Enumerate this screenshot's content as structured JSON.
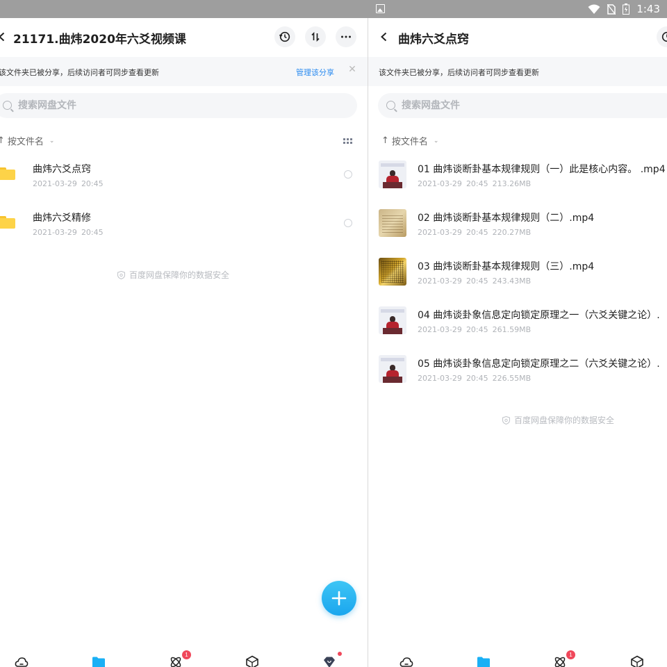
{
  "status_bar": {
    "time": "1:43"
  },
  "left_pane": {
    "title": "21171.曲炜2020年六爻视频课",
    "share_banner": {
      "text": "该文件夹已被分享，后续访问者可同步查看更新",
      "manage_link": "管理该分享"
    },
    "search": {
      "placeholder": "搜索网盘文件"
    },
    "sort_label": "按文件名",
    "items": [
      {
        "name": "曲炜六爻点窍",
        "date": "2021-03-29",
        "time": "20:45"
      },
      {
        "name": "曲炜六爻精修",
        "date": "2021-03-29",
        "time": "20:45"
      }
    ],
    "footer_note": "百度网盘保障你的数据安全",
    "tabbar": {
      "share_badge": "1"
    }
  },
  "right_pane": {
    "title": "曲炜六爻点窍",
    "share_banner": {
      "text": "该文件夹已被分享，后续访问者可同步查看更新"
    },
    "search": {
      "placeholder": "搜索网盘文件"
    },
    "sort_label": "按文件名",
    "items": [
      {
        "name": "01 曲炜谈断卦基本规律规则（一）此是核心内容。 .mp4",
        "date": "2021-03-29",
        "time": "20:45",
        "size": "213.26MB",
        "thumb": "person"
      },
      {
        "name": "02 曲炜谈断卦基本规律规则（二）.mp4",
        "date": "2021-03-29",
        "time": "20:45",
        "size": "220.27MB",
        "thumb": "paper"
      },
      {
        "name": "03 曲炜谈断卦基本规律规则（三）.mp4",
        "date": "2021-03-29",
        "time": "20:45",
        "size": "243.43MB",
        "thumb": "gold"
      },
      {
        "name": "04 曲炜谈卦象信息定向锁定原理之一（六爻关键之论）.",
        "date": "2021-03-29",
        "time": "20:45",
        "size": "261.59MB",
        "thumb": "person"
      },
      {
        "name": "05 曲炜谈卦象信息定向锁定原理之二（六爻关键之论）.",
        "date": "2021-03-29",
        "time": "20:45",
        "size": "226.55MB",
        "thumb": "person"
      }
    ],
    "footer_note": "百度网盘保障你的数据安全",
    "tabbar": {
      "share_badge": "1"
    }
  },
  "colors": {
    "accent": "#2d8cf0",
    "fab": "#1aa6ee",
    "folder": "#fdd348",
    "badge": "#f0485b",
    "status_bar": "#9e9e9e"
  }
}
